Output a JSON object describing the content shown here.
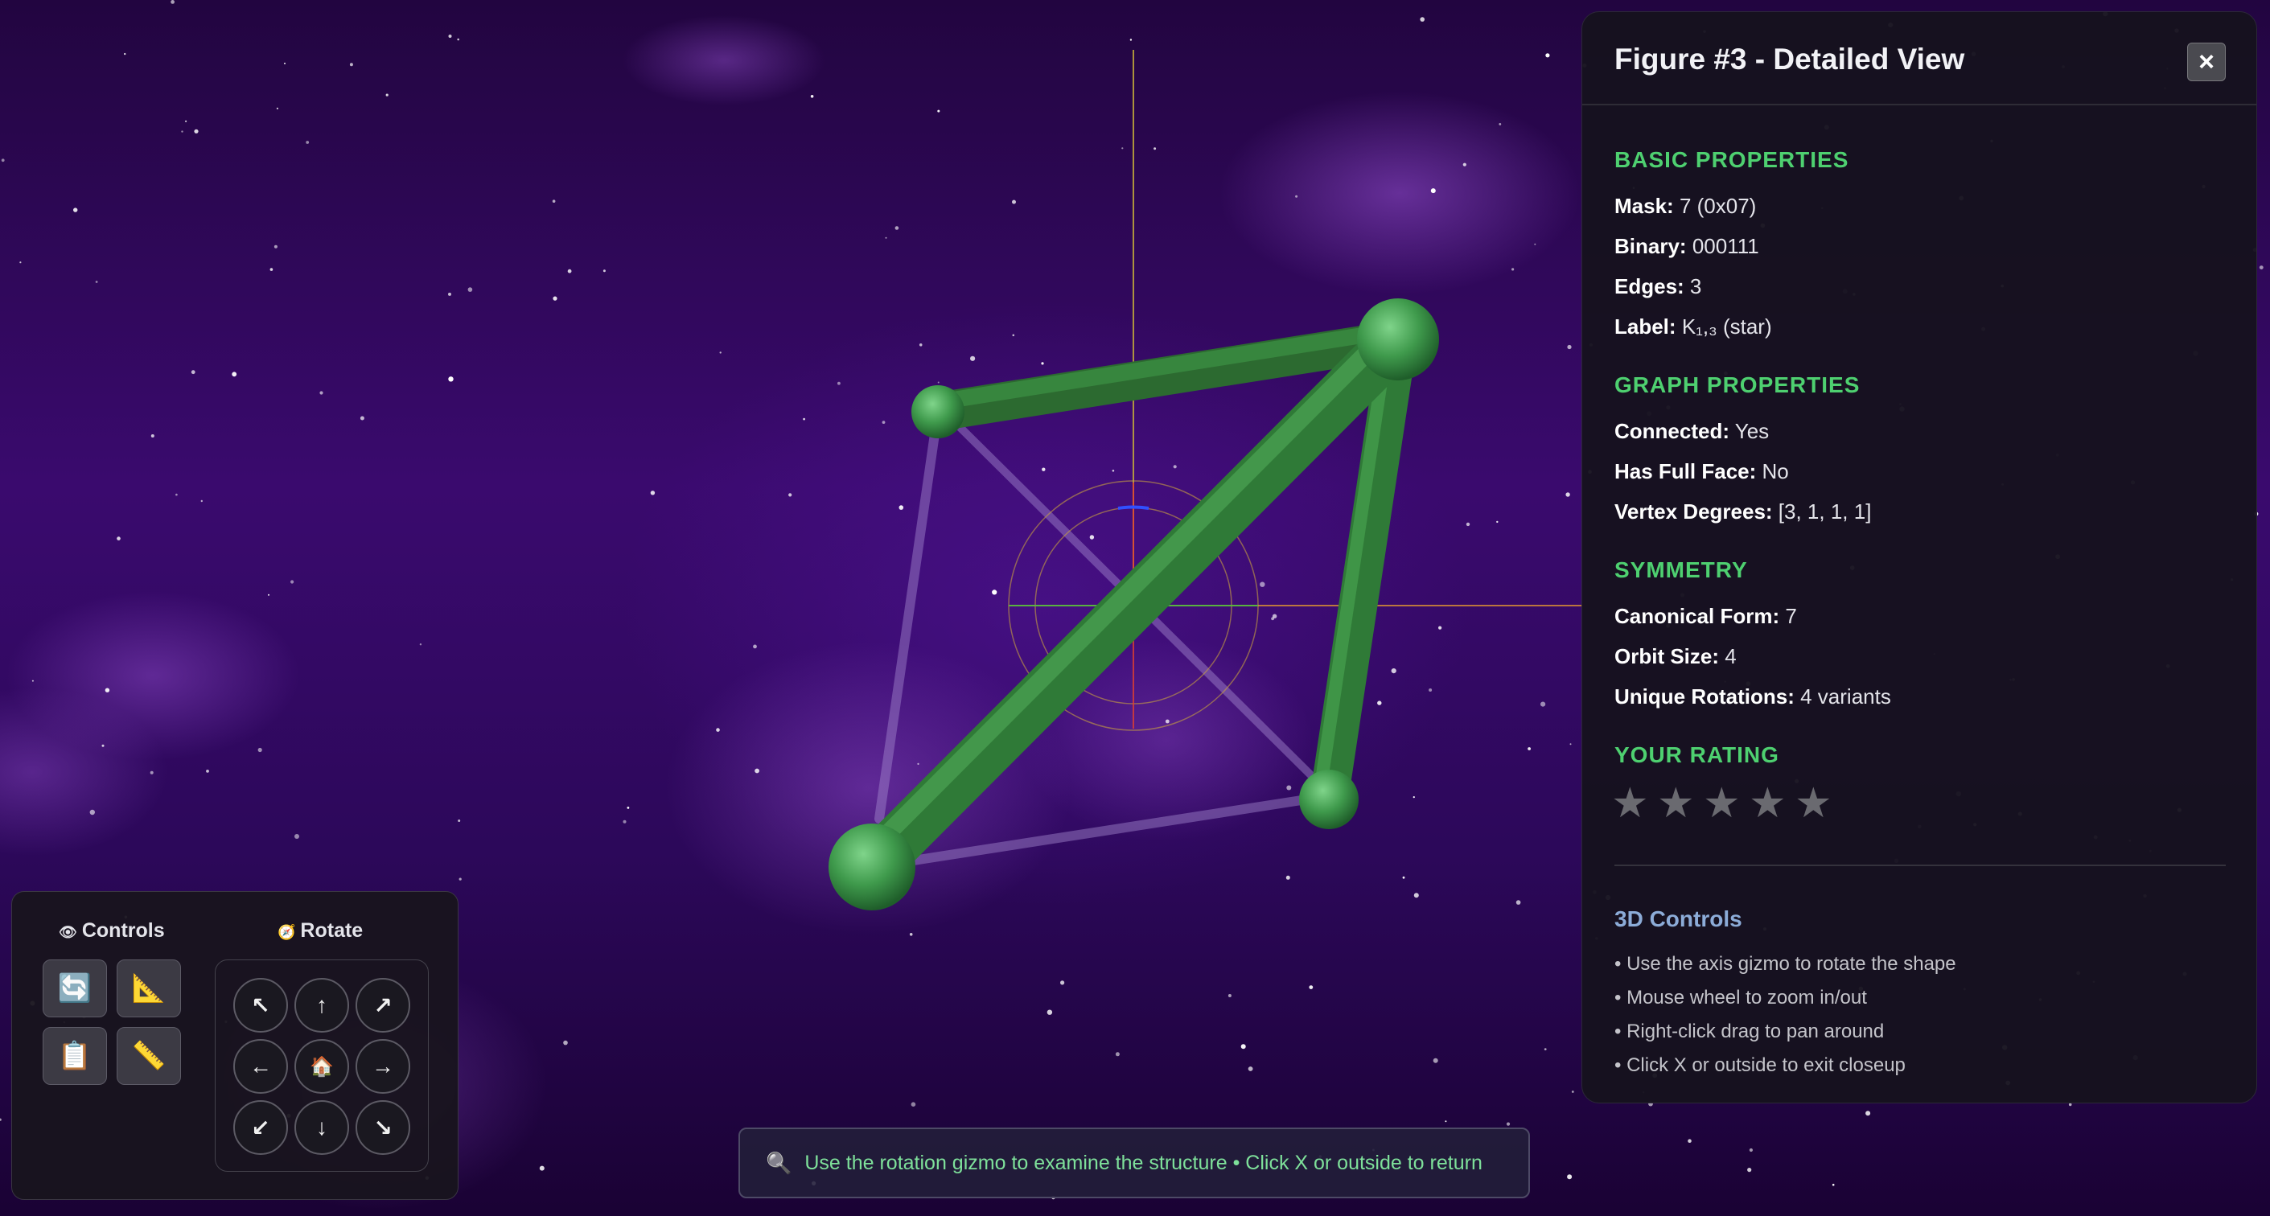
{
  "panel": {
    "title": "Figure #3 - Detailed View",
    "close_label": "×",
    "sections": {
      "basic": {
        "title": "BASIC PROPERTIES",
        "mask_label": "Mask:",
        "mask_value": "7 (0x07)",
        "binary_label": "Binary:",
        "binary_value": "000111",
        "edges_label": "Edges:",
        "edges_value": "3",
        "label_label": "Label:",
        "label_value": "K₁,₃ (star)"
      },
      "graph": {
        "title": "GRAPH PROPERTIES",
        "connected_label": "Connected:",
        "connected_value": "Yes",
        "fullface_label": "Has Full Face:",
        "fullface_value": "No",
        "degrees_label": "Vertex Degrees:",
        "degrees_value": "[3, 1, 1, 1]"
      },
      "symmetry": {
        "title": "SYMMETRY",
        "canonical_label": "Canonical Form:",
        "canonical_value": "7",
        "orbit_label": "Orbit Size:",
        "orbit_value": "4",
        "rotations_label": "Unique Rotations:",
        "rotations_value": "4 variants"
      },
      "rating": {
        "title": "YOUR RATING",
        "max": 5,
        "value": 0,
        "star_glyph": "★"
      }
    },
    "controls_help": {
      "title": "3D Controls",
      "hints": [
        "• Use the axis gizmo to rotate the shape",
        "• Mouse wheel to zoom in/out",
        "• Right-click drag to pan around",
        "• Click X or outside to exit closeup"
      ]
    }
  },
  "control_panel": {
    "controls_label": "Controls",
    "controls_icon": "eye-icon",
    "controls_icon_glyph": "👁",
    "rotate_label": "Rotate",
    "rotate_icon": "compass-icon",
    "rotate_icon_glyph": "🧭",
    "tools": [
      {
        "name": "refresh-button",
        "icon": "refresh-icon",
        "glyph": "🔄"
      },
      {
        "name": "triangle-ruler-button",
        "icon": "triangle-ruler-icon",
        "glyph": "📐"
      },
      {
        "name": "clipboard-button",
        "icon": "clipboard-icon",
        "glyph": "📋"
      },
      {
        "name": "ruler-button",
        "icon": "ruler-icon",
        "glyph": "📏"
      }
    ],
    "rotate_buttons": [
      {
        "name": "rotate-up-left-button",
        "glyph": "↖"
      },
      {
        "name": "rotate-up-button",
        "glyph": "↑"
      },
      {
        "name": "rotate-up-right-button",
        "glyph": "↗"
      },
      {
        "name": "rotate-left-button",
        "glyph": "←"
      },
      {
        "name": "rotate-home-button",
        "glyph": "🏠"
      },
      {
        "name": "rotate-right-button",
        "glyph": "→"
      },
      {
        "name": "rotate-down-left-button",
        "glyph": "↙"
      },
      {
        "name": "rotate-down-button",
        "glyph": "↓"
      },
      {
        "name": "rotate-down-right-button",
        "glyph": "↘"
      }
    ]
  },
  "hint_bar": {
    "icon": "magnifier-icon",
    "icon_glyph": "🔍",
    "text": "Use the rotation gizmo to examine the structure • Click X or outside to return"
  },
  "colors": {
    "accent_green": "#4ed070",
    "edge_green": "#3a9a48",
    "help_title": "#8cacd8",
    "background": "#2a0752"
  }
}
